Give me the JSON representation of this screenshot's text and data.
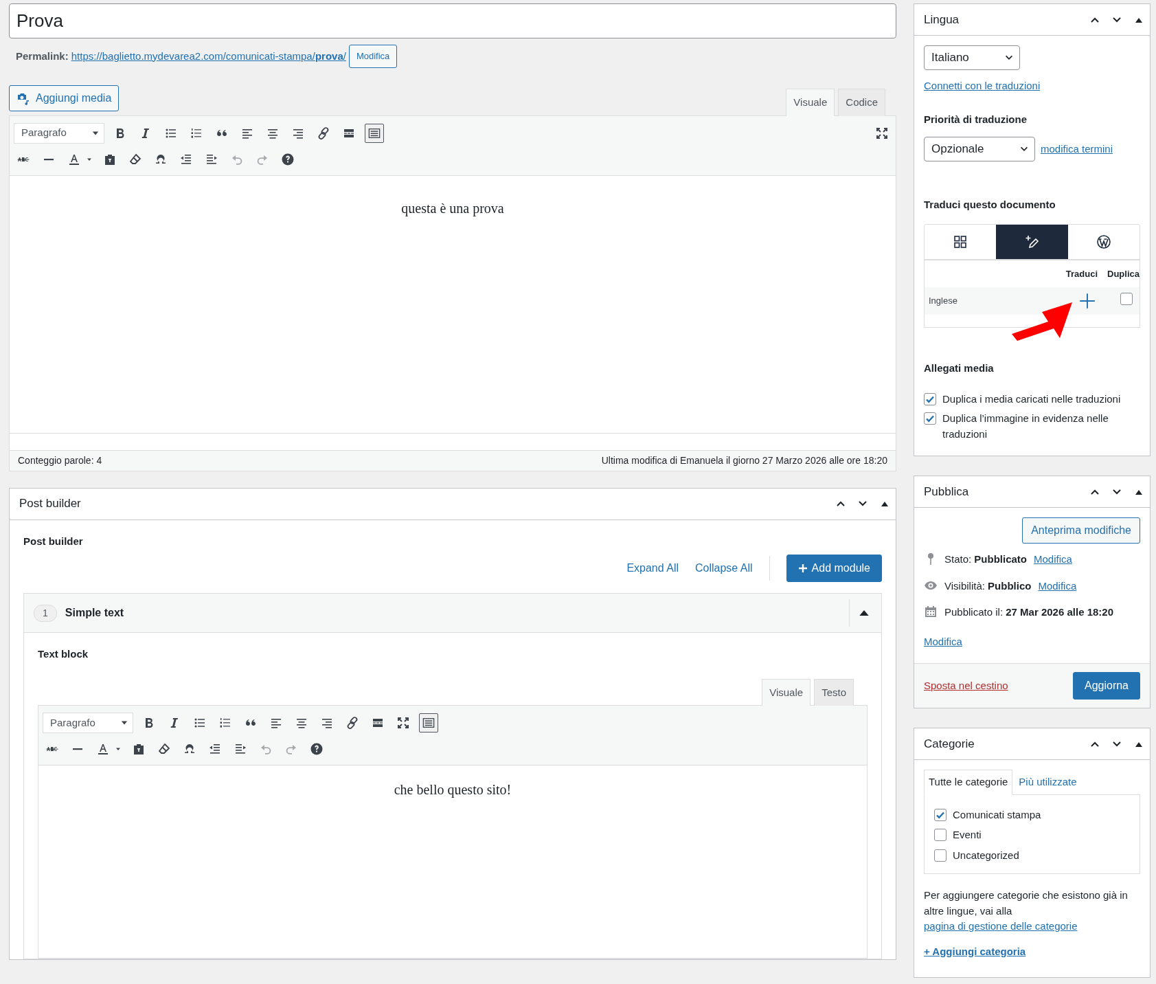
{
  "title_field": {
    "value": "Prova"
  },
  "permalink": {
    "label": "Permalink:",
    "url": "https://baglietto.mydevarea2.com/comunicati-stampa/**prova**/",
    "button": "Modifica"
  },
  "add_media_button": "Aggiungi media",
  "editor": {
    "tabs": [
      {
        "label": "Visuale",
        "selected": true
      },
      {
        "label": "Codice",
        "selected": false
      }
    ],
    "format": "Paragrafo",
    "toolbar_toggle_on": true,
    "content": "questa è una prova",
    "word_count": "Conteggio parole: 4",
    "last_modified": "Ultima modifica di Emanuela il giorno 27 Marzo 2026 alle ore 18:20"
  },
  "post_builder": {
    "title": "Post builder",
    "label": "Post builder",
    "expand_all": "Expand All",
    "collapse_all": "Collapse All",
    "add_module": "Add module",
    "modules": [
      {
        "number": "1",
        "title": "Simple text",
        "expanded": true,
        "field_label": "Text block",
        "editor": {
          "tabs": [
            {
              "label": "Visuale",
              "selected": true
            },
            {
              "label": "Testo",
              "selected": false
            }
          ],
          "format": "Paragrafo",
          "toolbar_toggle_on": true,
          "content": "che bello questo sito!"
        }
      }
    ]
  },
  "sidebar": {
    "lingua": {
      "title": "Lingua",
      "language": "Italiano",
      "connect_link": "Connetti con le traduzioni",
      "priority_label": "Priorità di traduzione",
      "priority": "Opzionale",
      "priority_link": "modifica termini",
      "translate_heading": "Traduci questo documento",
      "translate_tabs": [
        {
          "kind": "grid",
          "selected": false
        },
        {
          "kind": "translate",
          "selected": true
        },
        {
          "kind": "wordpress",
          "selected": false
        }
      ],
      "columns": [
        "Traduci",
        "Duplica"
      ],
      "languages": [
        {
          "name": "Inglese",
          "duplicate": false
        }
      ],
      "media_heading": "Allegati media",
      "media_options": [
        {
          "label": "Duplica i media caricati nelle traduzioni",
          "checked": true
        },
        {
          "label": "Duplica l’immagine in evidenza nelle traduzioni",
          "checked": true
        }
      ]
    },
    "pubblica": {
      "title": "Pubblica",
      "preview_button": "Anteprima modifiche",
      "items": [
        {
          "kind": "status",
          "text": "Stato: **Pubblicato**",
          "link": "Modifica"
        },
        {
          "kind": "visibility",
          "text": "Visibilità: **Pubblico**",
          "link": "Modifica"
        },
        {
          "kind": "date",
          "text": "Pubblicato il: **27 Mar 2026 alle 18:20**",
          "link": "Modifica"
        }
      ],
      "trash_link": "Sposta nel cestino",
      "update_button": "Aggiorna"
    },
    "categorie": {
      "title": "Categorie",
      "tabs": [
        {
          "label": "Tutte le categorie",
          "selected": true
        },
        {
          "label": "Più utilizzate",
          "selected": false
        }
      ],
      "categories": [
        {
          "label": "Comunicati stampa",
          "checked": true
        },
        {
          "label": "Eventi",
          "checked": false
        },
        {
          "label": "Uncategorized",
          "checked": false
        }
      ],
      "note": "Per aggiungere categorie che esistono già in altre lingue, vai alla",
      "note_link": "pagina di gestione delle categorie",
      "add_link": "+ Aggiungi categoria"
    }
  }
}
